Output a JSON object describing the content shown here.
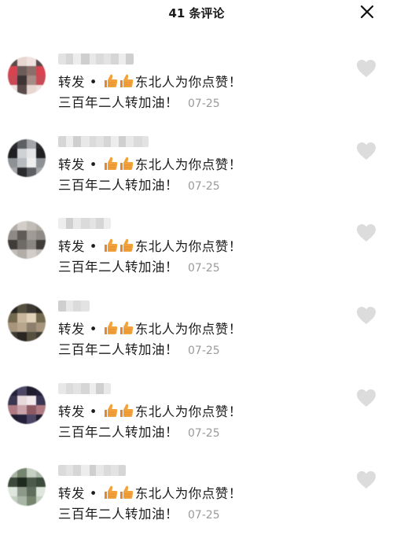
{
  "header": {
    "title": "41 条评论",
    "close_icon": "close-icon"
  },
  "colors": {
    "heart": "#dcdcdc",
    "date": "#9a9a9a",
    "thumb": "#f2a23a"
  },
  "comments": [
    {
      "prefix": "转发 • ",
      "suffix": "东北人为你点赞！",
      "line2": "三百年二人转加油！",
      "date": "07-25",
      "avatar": "pixelated-avatar",
      "like_icon": "heart-icon"
    },
    {
      "prefix": "转发 • ",
      "suffix": "东北人为你点赞！",
      "line2": "三百年二人转加油！",
      "date": "07-25",
      "avatar": "pixelated-avatar",
      "like_icon": "heart-icon"
    },
    {
      "prefix": "转发 • ",
      "suffix": "东北人为你点赞！",
      "line2": "三百年二人转加油！",
      "date": "07-25",
      "avatar": "pixelated-avatar",
      "like_icon": "heart-icon"
    },
    {
      "prefix": "转发 • ",
      "suffix": "东北人为你点赞！",
      "line2": "三百年二人转加油！",
      "date": "07-25",
      "avatar": "pixelated-avatar",
      "like_icon": "heart-icon"
    },
    {
      "prefix": "转发 • ",
      "suffix": "东北人为你点赞！",
      "line2": "三百年二人转加油！",
      "date": "07-25",
      "avatar": "pixelated-avatar",
      "like_icon": "heart-icon"
    },
    {
      "prefix": "转发 • ",
      "suffix": "东北人为你点赞！",
      "line2": "三百年二人转加油！",
      "date": "07-25",
      "avatar": "pixelated-avatar",
      "like_icon": "heart-icon"
    }
  ]
}
